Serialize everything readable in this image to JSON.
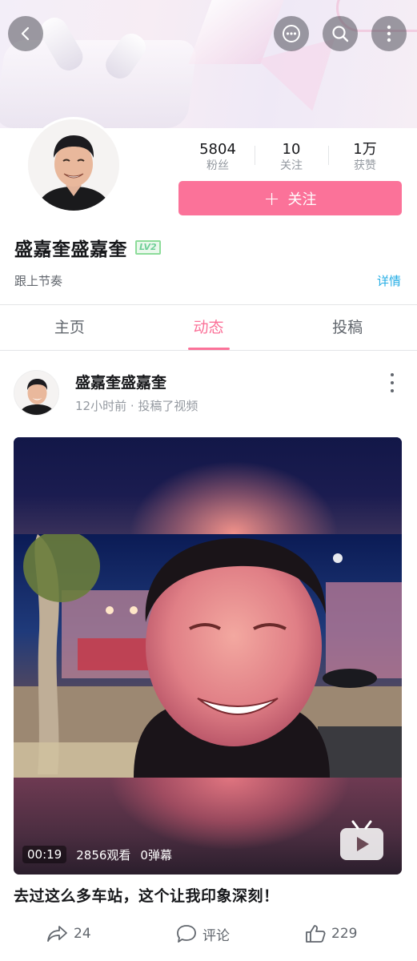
{
  "header": {
    "back_icon": "chevron-left-icon",
    "more_chat_icon": "chat-bubble-more-icon",
    "search_icon": "search-icon",
    "menu_icon": "vertical-ellipsis-icon"
  },
  "profile": {
    "stats": [
      {
        "value": "5804",
        "label": "粉丝"
      },
      {
        "value": "10",
        "label": "关注"
      },
      {
        "value": "1万",
        "label": "获赞"
      }
    ],
    "follow_label": "关注",
    "follow_plus": "+",
    "username": "盛嘉奎盛嘉奎",
    "level": "LV2",
    "signature": "跟上节奏",
    "detail_label": "详情"
  },
  "tabs": [
    {
      "label": "主页",
      "active": false
    },
    {
      "label": "动态",
      "active": true
    },
    {
      "label": "投稿",
      "active": false
    }
  ],
  "post": {
    "author": "盛嘉奎盛嘉奎",
    "meta": "12小时前 · 投稿了视频",
    "video": {
      "duration": "00:19",
      "views": "2856观看",
      "danmaku": "0弹幕",
      "play_icon": "bilibili-tv-play-icon"
    },
    "title": "去过这么多车站，这个让我印象深刻！",
    "actions": {
      "share_count": "24",
      "comment_label": "评论",
      "like_count": "229"
    }
  },
  "colors": {
    "accent": "#fb7299",
    "link": "#23ade5",
    "level_green": "#6fcf97",
    "text_primary": "#18191c",
    "text_secondary": "#9499a0"
  }
}
